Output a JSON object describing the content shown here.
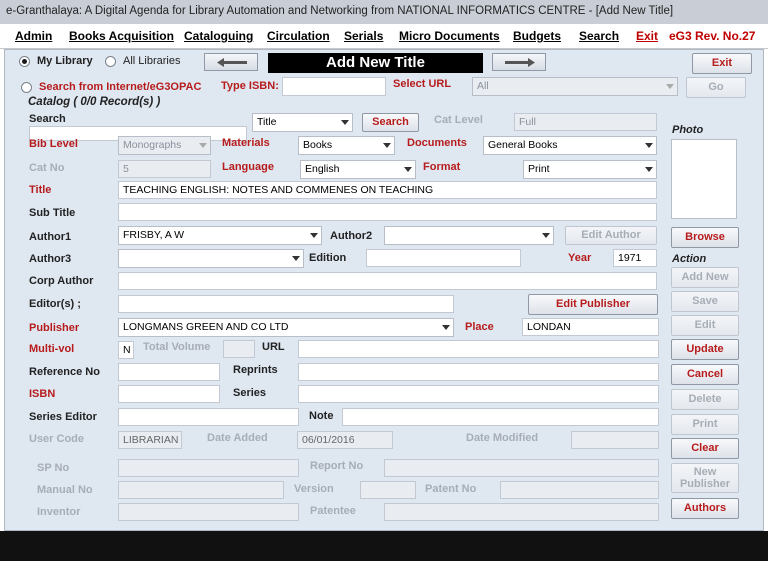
{
  "window": {
    "title": "e-Granthalaya: A Digital Agenda for Library Automation and Networking from NATIONAL INFORMATICS CENTRE - [Add New Title]"
  },
  "menu": {
    "admin": "Admin",
    "books_acquisition": "Books Acquisition",
    "cataloguing": "Cataloguing",
    "circulation": "Circulation",
    "serials": "Serials",
    "micro_documents": "Micro Documents",
    "budgets": "Budgets",
    "search": "Search",
    "exit": "Exit",
    "version": "eG3 Rev. No.27"
  },
  "header": {
    "my_library": "My Library",
    "all_libraries": "All Libraries",
    "banner": "Add New Title",
    "exit_button": "Exit",
    "search_internet": "Search from Internet/eG3OPAC",
    "type_isbn": "Type ISBN:",
    "select_url": "Select URL",
    "url_value": "All",
    "go_button": "Go",
    "catalog_count": "Catalog ( 0/0 Record(s) )"
  },
  "colors": {
    "panel": "#dfe7f1",
    "label_red": "#b71c1c",
    "disabled_gray": "#a7adb6"
  },
  "form": {
    "search_label": "Search",
    "search_field_value": "Title",
    "search_button": "Search",
    "cat_level_label": "Cat Level",
    "cat_level_value": "Full",
    "bib_level_label": "Bib Level",
    "bib_level_value": "Monographs",
    "materials_label": "Materials",
    "materials_value": "Books",
    "documents_label": "Documents",
    "documents_value": "General Books",
    "cat_no_label": "Cat No",
    "cat_no_value": "5",
    "language_label": "Language",
    "language_value": "English",
    "format_label": "Format",
    "format_value": "Print",
    "title_label": "Title",
    "title_value": "TEACHING ENGLISH: NOTES AND COMMENES ON TEACHING",
    "subtitle_label": "Sub Title",
    "author1_label": "Author1",
    "author1_value": "FRISBY, A W",
    "author2_label": "Author2",
    "edit_author_button": "Edit Author",
    "author3_label": "Author3",
    "edition_label": "Edition",
    "year_label": "Year",
    "year_value": "1971",
    "corp_author_label": "Corp Author",
    "editors_label": "Editor(s) ;",
    "edit_publisher_button": "Edit Publisher",
    "publisher_label": "Publisher",
    "publisher_value": "LONGMANS GREEN AND CO LTD",
    "place_label": "Place",
    "place_value": "LONDAN",
    "multivol_label": "Multi-vol",
    "multivol_value": "N",
    "total_volume_label": "Total Volume",
    "url_label": "URL",
    "reference_no_label": "Reference No",
    "reprints_label": "Reprints",
    "isbn_label": "ISBN",
    "series_label": "Series",
    "series_editor_label": "Series Editor",
    "note_label": "Note",
    "user_code_label": "User Code",
    "user_code_value": "LIBRARIAN",
    "date_added_label": "Date Added",
    "date_added_value": "06/01/2016",
    "date_modified_label": "Date Modified",
    "sp_no_label": "SP No",
    "report_no_label": "Report No",
    "manual_no_label": "Manual No",
    "version_label": "Version",
    "patent_no_label": "Patent No",
    "inventor_label": "Inventor",
    "patentee_label": "Patentee"
  },
  "side": {
    "photo_label": "Photo",
    "browse_button": "Browse",
    "action_label": "Action",
    "add_new": "Add New",
    "save": "Save",
    "edit": "Edit",
    "update": "Update",
    "cancel": "Cancel",
    "delete": "Delete",
    "print": "Print",
    "clear": "Clear",
    "new_publisher_line1": "New",
    "new_publisher_line2": "Publisher",
    "authors": "Authors"
  }
}
